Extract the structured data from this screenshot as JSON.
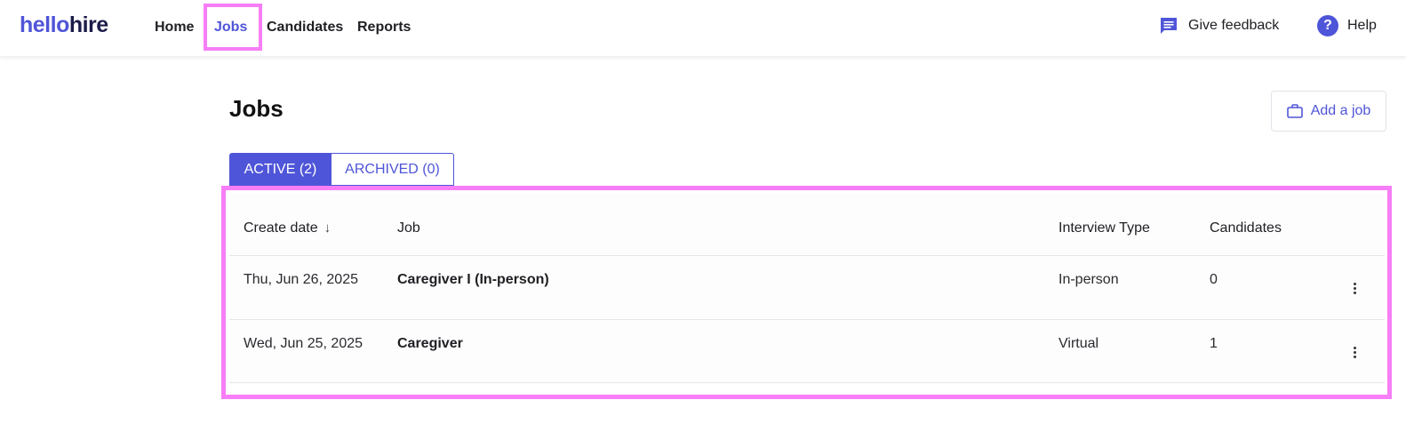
{
  "app": {
    "logo_part1": "hello",
    "logo_part2": "hire",
    "accent_color": "#4f55d8",
    "highlight_color": "#f77ef7"
  },
  "nav": {
    "items": [
      {
        "label": "Home"
      },
      {
        "label": "Jobs",
        "active": true
      },
      {
        "label": "Candidates"
      },
      {
        "label": "Reports"
      }
    ],
    "feedback_label": "Give feedback",
    "feedback_icon": "chat-bubble-icon",
    "help_label": "Help",
    "help_icon": "question-circle-icon"
  },
  "page": {
    "title": "Jobs",
    "add_job_label": "Add a job",
    "add_job_icon": "briefcase-icon"
  },
  "tabs": [
    {
      "label": "ACTIVE (2)",
      "active": true
    },
    {
      "label": "ARCHIVED (0)",
      "active": false
    }
  ],
  "table": {
    "columns": [
      "Create date",
      "Job",
      "Interview Type",
      "Candidates"
    ],
    "sort_indicator": "↓",
    "rows": [
      {
        "create_date": "Thu, Jun 26, 2025",
        "job": "Caregiver I (In-person)",
        "interview_type": "In-person",
        "candidates": "0"
      },
      {
        "create_date": "Wed, Jun 25, 2025",
        "job": "Caregiver",
        "interview_type": "Virtual",
        "candidates": "1"
      }
    ]
  }
}
